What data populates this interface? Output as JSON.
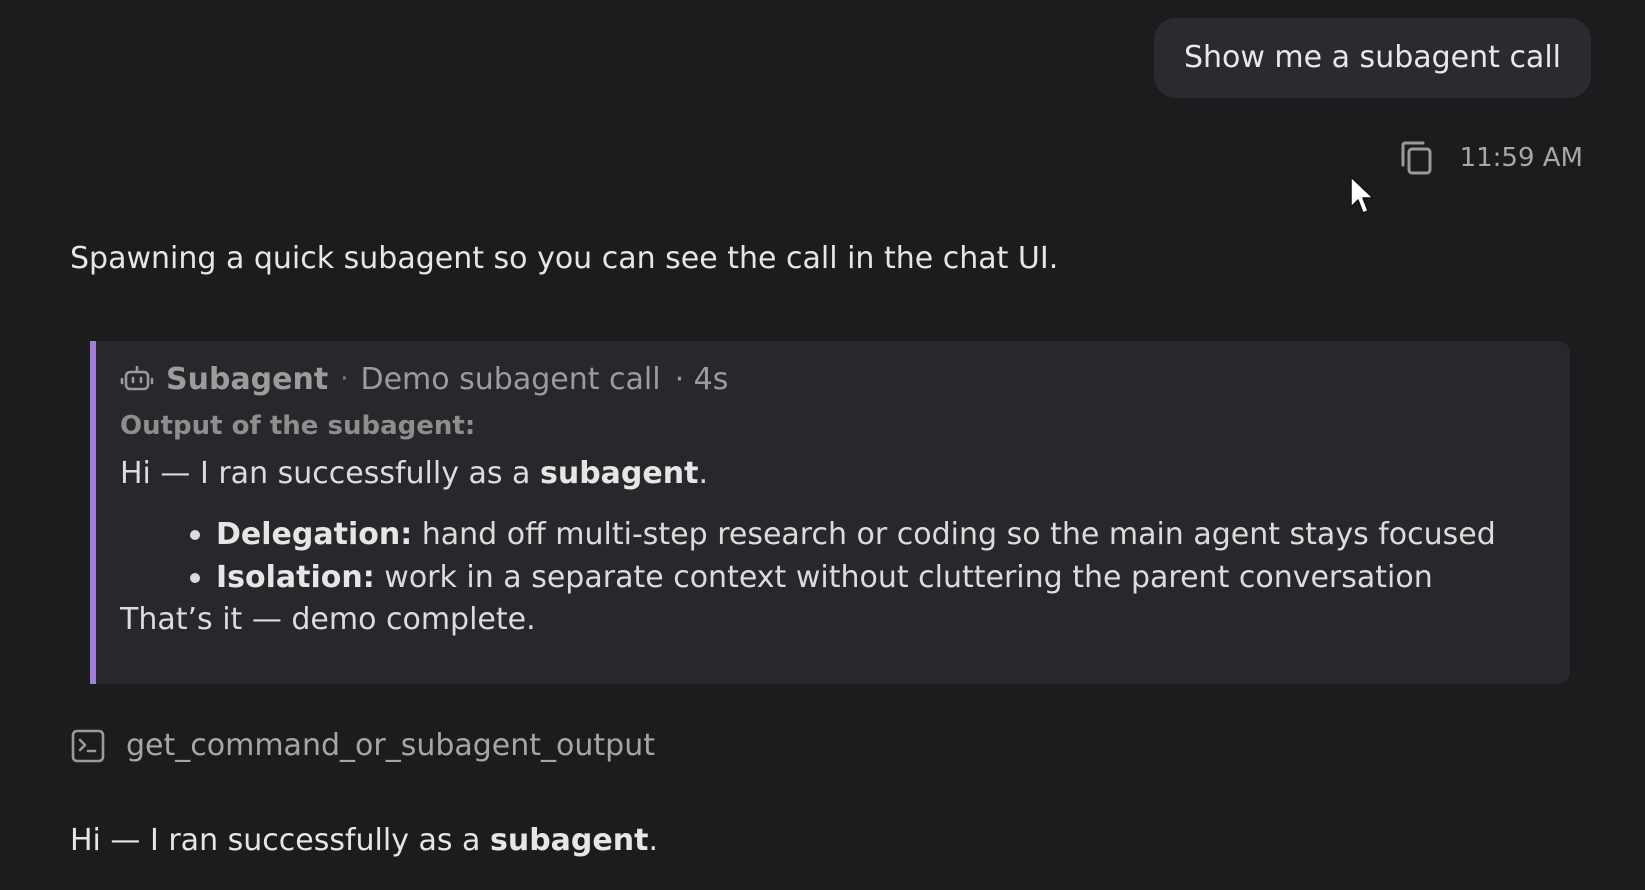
{
  "user_message": {
    "text": "Show me a subagent call",
    "time": "11:59 AM"
  },
  "assistant": {
    "intro": "Spawning a quick subagent so you can see the call in the chat UI."
  },
  "subagent": {
    "title": "Subagent",
    "separator": "·",
    "description": "Demo subagent call",
    "duration": "· 4s",
    "output_label": "Output of the subagent:",
    "intro_prefix": "Hi — I ran successfully as a ",
    "intro_bold": "subagent",
    "intro_suffix": ".",
    "bullets": [
      {
        "term": "Delegation:",
        "text": " hand off multi-step research or coding so the main agent stays focused"
      },
      {
        "term": "Isolation:",
        "text": " work in a separate context without cluttering the parent conversation"
      }
    ],
    "closing": "That’s it — demo complete.",
    "accent_color": "#a07ed8"
  },
  "tool_call": {
    "name": "get_command_or_subagent_output",
    "icon": "terminal-icon"
  },
  "final": {
    "prefix": "Hi — I ran successfully as a ",
    "bold": "subagent",
    "suffix": "."
  }
}
